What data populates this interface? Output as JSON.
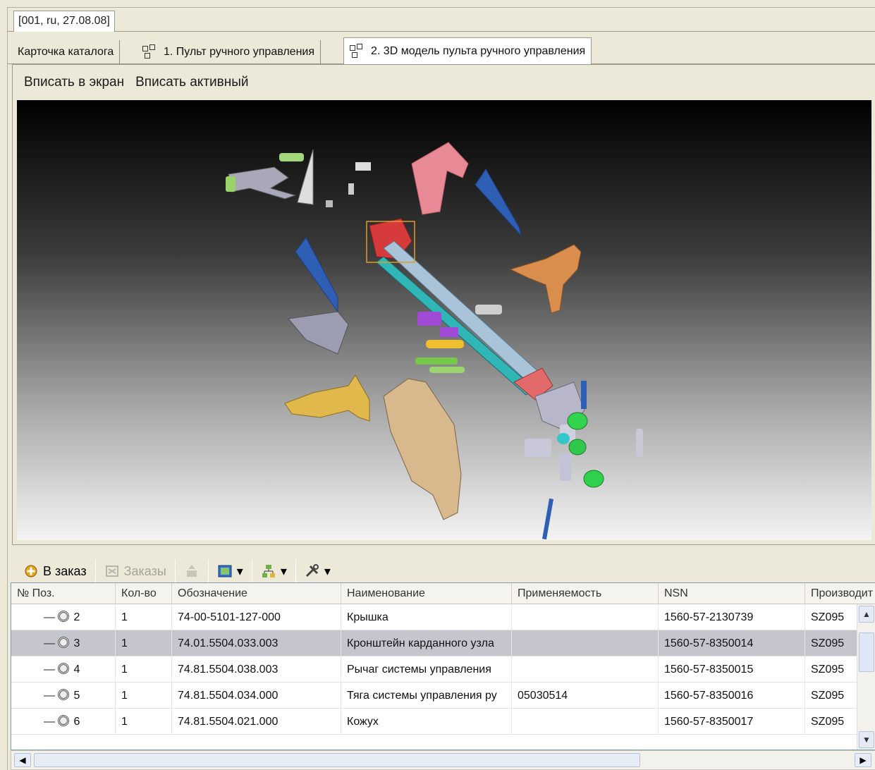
{
  "doc_tab": {
    "label": "[001, ru, 27.08.08]"
  },
  "tabs": [
    {
      "label": "Карточка каталога",
      "icon": "none"
    },
    {
      "label": "1. Пульт ручного управления",
      "icon": "model-icon"
    },
    {
      "label": "2. 3D модель пульта ручного управления",
      "icon": "model-icon",
      "active": true
    }
  ],
  "view_tools": {
    "fit_screen": "Вписать в экран",
    "fit_active": "Вписать активный"
  },
  "toolbar": {
    "add_order": "В заказ",
    "orders": "Заказы"
  },
  "columns": [
    "№ Поз.",
    "Кол-во",
    "Обозначение",
    "Наименование",
    "Применяемость",
    "NSN",
    "Производит"
  ],
  "rows": [
    {
      "pos": "2",
      "qty": "1",
      "designation": "74-00-5101-127-000",
      "name": "Крышка",
      "applicability": "",
      "nsn": "1560-57-2130739",
      "manufacturer": "SZ095"
    },
    {
      "pos": "3",
      "qty": "1",
      "designation": "74.01.5504.033.003",
      "name": "Кронштейн карданного узла",
      "applicability": "",
      "nsn": "1560-57-8350014",
      "manufacturer": "SZ095",
      "selected": true
    },
    {
      "pos": "4",
      "qty": "1",
      "designation": "74.81.5504.038.003",
      "name": "Рычаг системы управления",
      "applicability": "",
      "nsn": "1560-57-8350015",
      "manufacturer": "SZ095"
    },
    {
      "pos": "5",
      "qty": "1",
      "designation": "74.81.5504.034.000",
      "name": "Тяга системы управления ру",
      "applicability": "05030514",
      "nsn": "1560-57-8350016",
      "manufacturer": "SZ095"
    },
    {
      "pos": "6",
      "qty": "1",
      "designation": "74.81.5504.021.000",
      "name": "Кожух",
      "applicability": "",
      "nsn": "1560-57-8350017",
      "manufacturer": "SZ095"
    }
  ],
  "colors": {
    "selected_row": "#c5c5cd",
    "grid_border": "#7f9db9",
    "accent": "#316ac5"
  }
}
